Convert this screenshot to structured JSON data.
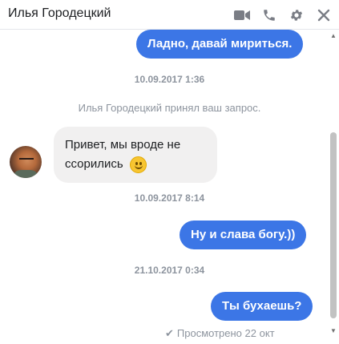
{
  "header": {
    "title": "Илья Городецкий",
    "icons": [
      "video-call-icon",
      "phone-call-icon",
      "settings-gear-icon",
      "close-icon"
    ]
  },
  "messages": {
    "out_1": "Ладно, давай мириться.",
    "timestamp_1": "10.09.2017 1:36",
    "system_1": "Илья Городецкий принял ваш запрос.",
    "in_1_line1": "Привет, мы вроде не",
    "in_1_line2": "ссорились",
    "timestamp_2": "10.09.2017 8:14",
    "out_2": "Ну и слава богу.))",
    "timestamp_3": "21.10.2017 0:34",
    "out_3": "Ты бухаешь?",
    "seen_status": "Просмотрено 22 окт"
  },
  "colors": {
    "accent": "#3c76e6",
    "incoming_bg": "#f1f0f0",
    "muted_text": "#8d949e"
  }
}
